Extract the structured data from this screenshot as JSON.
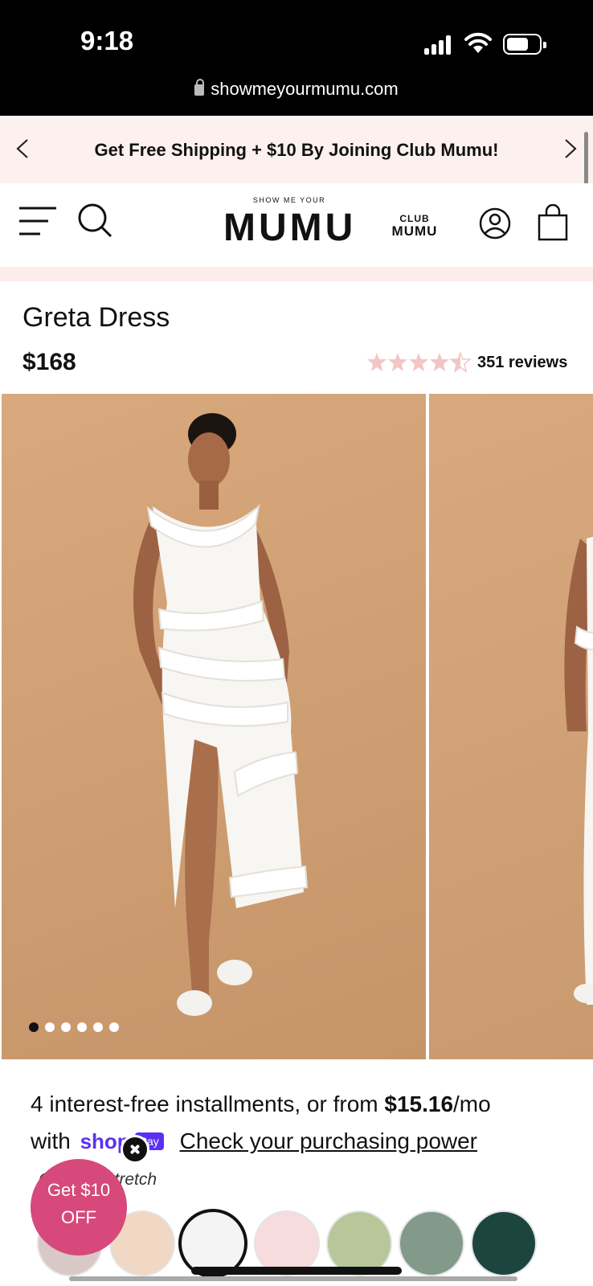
{
  "status_bar": {
    "time": "9:18",
    "url": "showmeyourmumu.com"
  },
  "promo": {
    "text": "Get Free Shipping + $10 By Joining Club Mumu!"
  },
  "header": {
    "logo_small": "SHOW ME YOUR",
    "logo_big": "MUMU",
    "club_top": "CLUB",
    "club_bottom": "MUMU"
  },
  "product": {
    "title": "Greta Dress",
    "price": "$168",
    "rating": 4.5,
    "reviews": "351 reviews",
    "images_count": 6,
    "active_image": 0
  },
  "payment": {
    "installments": "4 interest-free installments, or from ",
    "amount": "$15.16",
    "per": "/mo",
    "with": "with",
    "shop_pay": "shop",
    "pay_chip": "Pay",
    "check": "Check your purchasing power"
  },
  "color_label": "C      White Stretch",
  "swatches": [
    {
      "color": "#d8c8c6"
    },
    {
      "color": "#f0d8c4"
    },
    {
      "color": "#f4f4f4",
      "selected": true
    },
    {
      "color": "#f6dcdc"
    },
    {
      "color": "#b8c79a"
    },
    {
      "color": "#83998a"
    },
    {
      "color": "#1c4540"
    }
  ],
  "popup": {
    "line1": "Get $10",
    "line2": "OFF"
  }
}
